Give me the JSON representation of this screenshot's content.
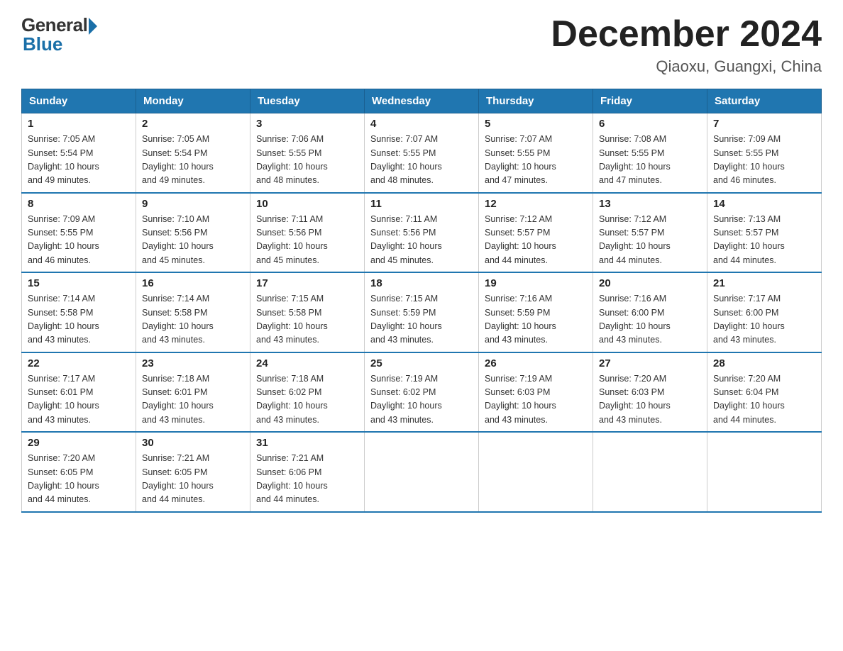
{
  "header": {
    "logo_general": "General",
    "logo_blue": "Blue",
    "title": "December 2024",
    "subtitle": "Qiaoxu, Guangxi, China"
  },
  "days_of_week": [
    "Sunday",
    "Monday",
    "Tuesday",
    "Wednesday",
    "Thursday",
    "Friday",
    "Saturday"
  ],
  "weeks": [
    [
      {
        "day": "1",
        "info": "Sunrise: 7:05 AM\nSunset: 5:54 PM\nDaylight: 10 hours\nand 49 minutes."
      },
      {
        "day": "2",
        "info": "Sunrise: 7:05 AM\nSunset: 5:54 PM\nDaylight: 10 hours\nand 49 minutes."
      },
      {
        "day": "3",
        "info": "Sunrise: 7:06 AM\nSunset: 5:55 PM\nDaylight: 10 hours\nand 48 minutes."
      },
      {
        "day": "4",
        "info": "Sunrise: 7:07 AM\nSunset: 5:55 PM\nDaylight: 10 hours\nand 48 minutes."
      },
      {
        "day": "5",
        "info": "Sunrise: 7:07 AM\nSunset: 5:55 PM\nDaylight: 10 hours\nand 47 minutes."
      },
      {
        "day": "6",
        "info": "Sunrise: 7:08 AM\nSunset: 5:55 PM\nDaylight: 10 hours\nand 47 minutes."
      },
      {
        "day": "7",
        "info": "Sunrise: 7:09 AM\nSunset: 5:55 PM\nDaylight: 10 hours\nand 46 minutes."
      }
    ],
    [
      {
        "day": "8",
        "info": "Sunrise: 7:09 AM\nSunset: 5:55 PM\nDaylight: 10 hours\nand 46 minutes."
      },
      {
        "day": "9",
        "info": "Sunrise: 7:10 AM\nSunset: 5:56 PM\nDaylight: 10 hours\nand 45 minutes."
      },
      {
        "day": "10",
        "info": "Sunrise: 7:11 AM\nSunset: 5:56 PM\nDaylight: 10 hours\nand 45 minutes."
      },
      {
        "day": "11",
        "info": "Sunrise: 7:11 AM\nSunset: 5:56 PM\nDaylight: 10 hours\nand 45 minutes."
      },
      {
        "day": "12",
        "info": "Sunrise: 7:12 AM\nSunset: 5:57 PM\nDaylight: 10 hours\nand 44 minutes."
      },
      {
        "day": "13",
        "info": "Sunrise: 7:12 AM\nSunset: 5:57 PM\nDaylight: 10 hours\nand 44 minutes."
      },
      {
        "day": "14",
        "info": "Sunrise: 7:13 AM\nSunset: 5:57 PM\nDaylight: 10 hours\nand 44 minutes."
      }
    ],
    [
      {
        "day": "15",
        "info": "Sunrise: 7:14 AM\nSunset: 5:58 PM\nDaylight: 10 hours\nand 43 minutes."
      },
      {
        "day": "16",
        "info": "Sunrise: 7:14 AM\nSunset: 5:58 PM\nDaylight: 10 hours\nand 43 minutes."
      },
      {
        "day": "17",
        "info": "Sunrise: 7:15 AM\nSunset: 5:58 PM\nDaylight: 10 hours\nand 43 minutes."
      },
      {
        "day": "18",
        "info": "Sunrise: 7:15 AM\nSunset: 5:59 PM\nDaylight: 10 hours\nand 43 minutes."
      },
      {
        "day": "19",
        "info": "Sunrise: 7:16 AM\nSunset: 5:59 PM\nDaylight: 10 hours\nand 43 minutes."
      },
      {
        "day": "20",
        "info": "Sunrise: 7:16 AM\nSunset: 6:00 PM\nDaylight: 10 hours\nand 43 minutes."
      },
      {
        "day": "21",
        "info": "Sunrise: 7:17 AM\nSunset: 6:00 PM\nDaylight: 10 hours\nand 43 minutes."
      }
    ],
    [
      {
        "day": "22",
        "info": "Sunrise: 7:17 AM\nSunset: 6:01 PM\nDaylight: 10 hours\nand 43 minutes."
      },
      {
        "day": "23",
        "info": "Sunrise: 7:18 AM\nSunset: 6:01 PM\nDaylight: 10 hours\nand 43 minutes."
      },
      {
        "day": "24",
        "info": "Sunrise: 7:18 AM\nSunset: 6:02 PM\nDaylight: 10 hours\nand 43 minutes."
      },
      {
        "day": "25",
        "info": "Sunrise: 7:19 AM\nSunset: 6:02 PM\nDaylight: 10 hours\nand 43 minutes."
      },
      {
        "day": "26",
        "info": "Sunrise: 7:19 AM\nSunset: 6:03 PM\nDaylight: 10 hours\nand 43 minutes."
      },
      {
        "day": "27",
        "info": "Sunrise: 7:20 AM\nSunset: 6:03 PM\nDaylight: 10 hours\nand 43 minutes."
      },
      {
        "day": "28",
        "info": "Sunrise: 7:20 AM\nSunset: 6:04 PM\nDaylight: 10 hours\nand 44 minutes."
      }
    ],
    [
      {
        "day": "29",
        "info": "Sunrise: 7:20 AM\nSunset: 6:05 PM\nDaylight: 10 hours\nand 44 minutes."
      },
      {
        "day": "30",
        "info": "Sunrise: 7:21 AM\nSunset: 6:05 PM\nDaylight: 10 hours\nand 44 minutes."
      },
      {
        "day": "31",
        "info": "Sunrise: 7:21 AM\nSunset: 6:06 PM\nDaylight: 10 hours\nand 44 minutes."
      },
      null,
      null,
      null,
      null
    ]
  ]
}
